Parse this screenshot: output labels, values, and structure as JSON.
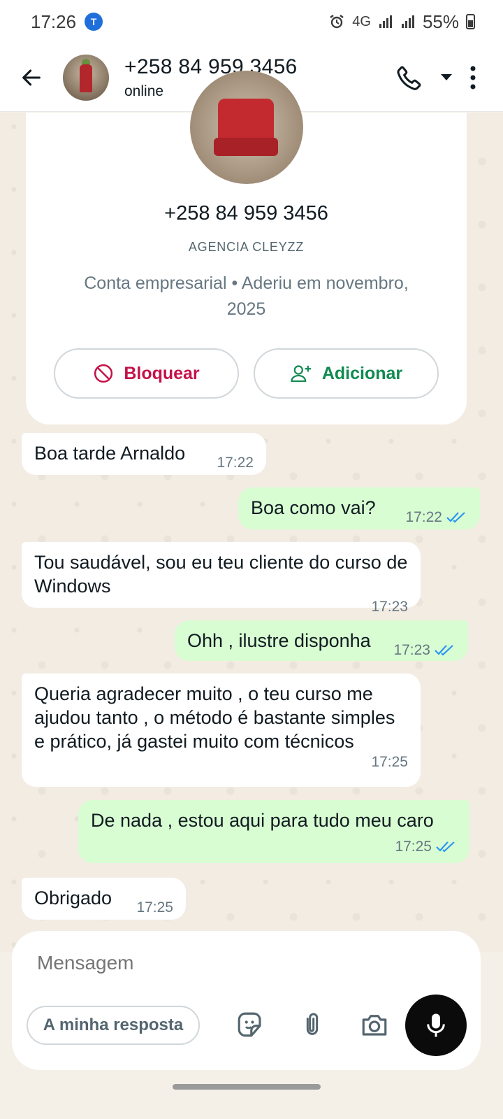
{
  "status_bar": {
    "time": "17:26",
    "network": "4G",
    "battery": "55%"
  },
  "header": {
    "title": "+258 84 959 3456",
    "subtitle": "online"
  },
  "profile_card": {
    "phone": "+258 84 959 3456",
    "name": "AGENCIA CLEYZZ",
    "description": "Conta empresarial • Aderiu em novembro, 2025",
    "block_label": "Bloquear",
    "add_label": "Adicionar"
  },
  "messages": [
    {
      "direction": "in",
      "text": "Boa tarde Arnaldo",
      "time": "17:22"
    },
    {
      "direction": "out",
      "text": "Boa como vai?",
      "time": "17:22",
      "read": true
    },
    {
      "direction": "in",
      "text": "Tou saudável, sou eu teu cliente do curso de Windows",
      "time": "17:23"
    },
    {
      "direction": "out",
      "text": "Ohh , ilustre disponha",
      "time": "17:23",
      "read": true
    },
    {
      "direction": "in",
      "text": "Queria agradecer muito , o teu curso me ajudou tanto , o método é bastante simples e prático, já gastei muito com técnicos",
      "time": "17:25"
    },
    {
      "direction": "out",
      "text": "De nada , estou aqui para tudo meu caro",
      "time": "17:25",
      "read": true
    },
    {
      "direction": "in",
      "text": "Obrigado",
      "time": "17:25"
    }
  ],
  "composer": {
    "placeholder": "Mensagem",
    "quick_reply": "A minha resposta"
  },
  "colors": {
    "outgoing_bubble": "#d9fdd3",
    "incoming_bubble": "#ffffff",
    "read_ticks": "#2a97f0",
    "block_red": "#c4124a",
    "add_green": "#108a50"
  }
}
